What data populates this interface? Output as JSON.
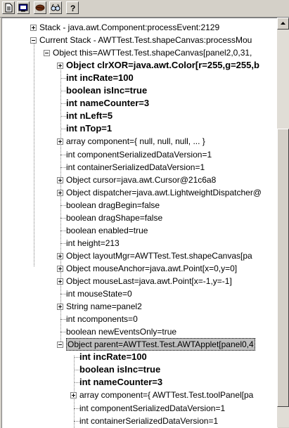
{
  "toolbar": {
    "buttons": [
      {
        "name": "document-icon"
      },
      {
        "name": "console-icon"
      },
      {
        "name": "coffee-bean-icon"
      },
      {
        "name": "glasses-icon"
      },
      {
        "name": "help-icon"
      }
    ]
  },
  "tree": {
    "rows": [
      {
        "text": "Stack - java.awt.Component:processEvent:2129",
        "toggle": "plus",
        "bold": false
      },
      {
        "text": "Current Stack - AWTTest.Test.shapeCanvas:processMou",
        "toggle": "minus",
        "bold": false
      },
      {
        "text": "Object this=AWTTest.Test.shapeCanvas[panel2,0,31,",
        "toggle": "minus",
        "bold": false
      },
      {
        "text": "Object clrXOR=java.awt.Color[r=255,g=255,b",
        "toggle": "plus",
        "bold": true
      },
      {
        "text": "int incRate=100",
        "toggle": "none",
        "bold": true
      },
      {
        "text": "boolean isInc=true",
        "toggle": "none",
        "bold": true
      },
      {
        "text": "int nameCounter=3",
        "toggle": "none",
        "bold": true
      },
      {
        "text": "int nLeft=5",
        "toggle": "none",
        "bold": true
      },
      {
        "text": "int nTop=1",
        "toggle": "none",
        "bold": true
      },
      {
        "text": "array component={ null, null, null, ... }",
        "toggle": "plus",
        "bold": false
      },
      {
        "text": "int componentSerializedDataVersion=1",
        "toggle": "none",
        "bold": false
      },
      {
        "text": "int containerSerializedDataVersion=1",
        "toggle": "none",
        "bold": false
      },
      {
        "text": "Object cursor=java.awt.Cursor@21c6a8",
        "toggle": "plus",
        "bold": false
      },
      {
        "text": "Object dispatcher=java.awt.LightweightDispatcher@",
        "toggle": "plus",
        "bold": false
      },
      {
        "text": "boolean dragBegin=false",
        "toggle": "none",
        "bold": false
      },
      {
        "text": "boolean dragShape=false",
        "toggle": "none",
        "bold": false
      },
      {
        "text": "boolean enabled=true",
        "toggle": "none",
        "bold": false
      },
      {
        "text": "int height=213",
        "toggle": "none",
        "bold": false
      },
      {
        "text": "Object layoutMgr=AWTTest.Test.shapeCanvas[pa",
        "toggle": "plus",
        "bold": false
      },
      {
        "text": "Object mouseAnchor=java.awt.Point[x=0,y=0]",
        "toggle": "plus",
        "bold": false
      },
      {
        "text": "Object mouseLast=java.awt.Point[x=-1,y=-1]",
        "toggle": "plus",
        "bold": false
      },
      {
        "text": "int mouseState=0",
        "toggle": "none",
        "bold": false
      },
      {
        "text": "String name=panel2",
        "toggle": "plus",
        "bold": false
      },
      {
        "text": "int ncomponents=0",
        "toggle": "none",
        "bold": false
      },
      {
        "text": "boolean newEventsOnly=true",
        "toggle": "none",
        "bold": false
      },
      {
        "text": "Object parent=AWTTest.Test.AWTApplet[panel0,4",
        "toggle": "minus",
        "bold": false,
        "selected": true
      },
      {
        "text": "int incRate=100",
        "toggle": "none",
        "bold": true
      },
      {
        "text": "boolean isInc=true",
        "toggle": "none",
        "bold": true
      },
      {
        "text": "int nameCounter=3",
        "toggle": "none",
        "bold": true
      },
      {
        "text": "array component={ AWTTest.Test.toolPanel[pa",
        "toggle": "plus",
        "bold": false
      },
      {
        "text": "int componentSerializedDataVersion=1",
        "toggle": "none",
        "bold": false
      },
      {
        "text": "int containerSerializedDataVersion=1",
        "toggle": "none",
        "bold": false
      }
    ]
  }
}
